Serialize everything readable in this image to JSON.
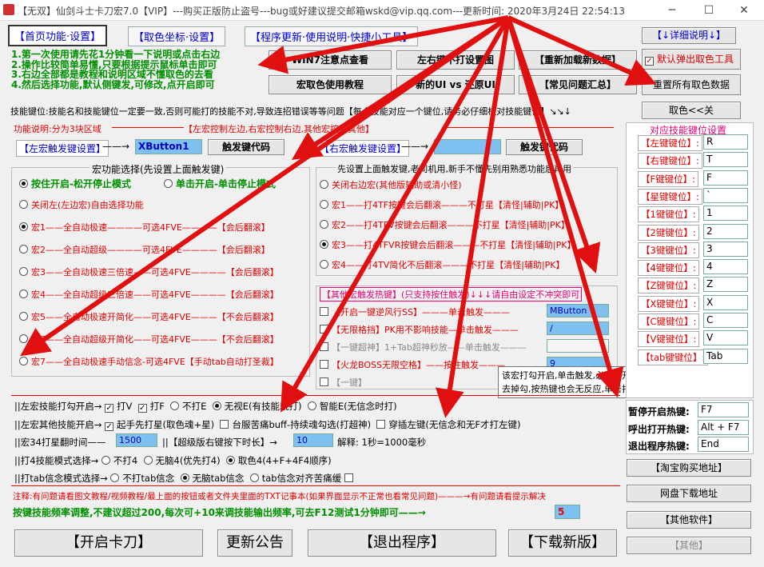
{
  "window": {
    "title": "【无双】仙剑斗士卡刀宏7.0【VIP】---购买正版防止盗号---bug或好建议提交邮箱wskd@vip.qq.com---更新时间: 2020年3月24日 22:54:13",
    "minimize": "─",
    "maximize": "☐",
    "close": "✕"
  },
  "tabs": [
    "【首页功能·设置】",
    "【取色坐标·设置】",
    "【程序更新·使用说明·快捷小工具】"
  ],
  "detail_btn": "【↓详细说明↓】",
  "intro": [
    "1.第一次使用请先花1分钟看一下说明或点击右边",
    "2.操作比较简单易懂,只要根据提示鼠标单击即可",
    "3.右边全部都是教程和说明区域不懂取色的去看",
    "4.然后选择功能,默认侧键发,可修改,点开启即可"
  ],
  "tut_buttons": [
    "WIN7注意点查看",
    "左右键不打设置图",
    "【重新加载新数据】",
    "宏取色使用教程",
    "新的UI vs 还原UI",
    "【常见问题汇总】"
  ],
  "popup_check": "默认弹出取色工具",
  "reset_btn": "重置所有取色数据",
  "skill_note": "技能键位:技能名和技能键位一定要一致,否则可能打的技能不对,导致连招错误等等问题【每个技能对应一个键位,请务必仔细核对技能键位】↘↘↓",
  "color_off": "取色<<关",
  "func_note": "功能说明:分为3块区域",
  "func_note2": "【左宏控制左边,右宏控制右边,其他宏控制其他】",
  "left_trigger": {
    "label": "【左宏触发键设置】",
    "value": "XButton1",
    "btn": "触发键代码"
  },
  "right_trigger": {
    "label": "【右宏触发键设置】",
    "value": "",
    "btn": "触发键代码"
  },
  "macro_title": "宏功能选择(先设置上面触发键)",
  "hold_mode": "按住开启-松开停止模式",
  "click_mode": "单击开启-单击停止模式",
  "left_macros": [
    "关闭左(左边宏)自由选择功能",
    "宏1——全自动极速————可选4FVE————【会后翻滚】",
    "宏2——全自动超级————可选4FVE————【会后翻滚】",
    "宏3——全自动极速三倍速——可选4FVE————【会后翻滚】",
    "宏4——全自动超级三倍速——可选4FVE————【会后翻滚】",
    "宏5——全自动极速开简化——可选4FVE———【不会后翻滚】",
    "宏6——全自动超级开简化——可选4FVE———【不会后翻滚】",
    "宏7——全自动极速手动信念-可选4FVE【手动tab自动打圣裁】"
  ],
  "right_title": "先设置上面触发键,老司机用,新手不懂先别用熟悉功能后再用",
  "right_macros": [
    "关闭右边宏(其他版辅助或清小怪)",
    "宏1——打4TF按键会后翻滚———不打星【清怪|辅助|PK】",
    "宏2——打4TFV按键会后翻滚———不打星【清怪|辅助|PK】",
    "宏3——打4TFVR按键会后翻滚———不打星【清怪|辅助|PK】",
    "宏4——打4TV简化不后翻滚———不打星【清怪|辅助|PK】"
  ],
  "other_title": "【其他宏触发热键】(只支持按住触发)↓↓↓请自由设定不冲突即可",
  "other_rows": [
    {
      "name": "【开启一键逆风行SS】",
      "mode": "———单击触发———",
      "value": "MButton"
    },
    {
      "name": "【无限格挡】PK用不影响技能",
      "mode": "—单击触发———",
      "value": "/"
    },
    {
      "name": "【一键超神】1+Tab超神秒放",
      "mode": "——单击触发———",
      "value": ""
    },
    {
      "name": "【火龙BOSS无限空格】",
      "mode": "——按住触发———",
      "value": "9"
    },
    {
      "name": "【一键】",
      "mode": "",
      "value": ""
    }
  ],
  "tooltip": [
    "该宏打勾开启,单击触发,必须松开其他卡刀宏热键",
    "去掉勾,按热键也会无反应,单击打勾开启!!!^_^"
  ],
  "opt1": {
    "label": "||左宏技能打勾开启→",
    "items": [
      "打V",
      "打F",
      "不打E",
      "无视E(有技能就打)",
      "智能E(无信念时打)"
    ]
  },
  "opt2": {
    "label": "||左宏其他技能开启→",
    "items": [
      "起手先打星(取色魂+星)",
      "台服苦痛buff-持续魂勾选(打超神)",
      "穿插左键(无信念和无F才打左键)"
    ]
  },
  "opt3": {
    "label": "||宏34打星翻时间——",
    "value1": "1500",
    "mid": "||【超级版右键按下时长】→",
    "value2": "10",
    "note": "解释: 1秒=1000毫秒"
  },
  "opt4": {
    "label": "||打4技能模式选择→",
    "items": [
      "不打4",
      "无脑4(优先打4)",
      "取色4(4+F+4F4顺序)"
    ]
  },
  "opt5": {
    "label": "||打tab信念模式选择→",
    "items": [
      "不打tab信念",
      "无脑tab信念",
      "tab信念对齐苦痛缓"
    ]
  },
  "note_bottom": "注释:有问题请看图文教程/视频教程/最上面的按钮或者文件夹里面的TXT记事本(如果界面显示不正常也看常见问题)———→有问题请看提示解决",
  "freq": {
    "text": "按键技能频率调整,不建议超过200,每次可+10来调技能输出频率,可去F12测试1分钟即可——→",
    "value": "5"
  },
  "bottom_buttons": [
    "【开启卡刀】",
    "更新公告",
    "【退出程序】",
    "【下载新版】"
  ],
  "right_panel": {
    "title": "对应技能键位设置",
    "keys": [
      {
        "label": "【左键键位】:",
        "value": "R"
      },
      {
        "label": "【右键键位】:",
        "value": "T"
      },
      {
        "label": "【F键键位】:",
        "value": "F"
      },
      {
        "label": "【星键键位】:",
        "value": "`"
      },
      {
        "label": "【1键键位】:",
        "value": "1"
      },
      {
        "label": "【2键键位】:",
        "value": "2"
      },
      {
        "label": "【3键键位】:",
        "value": "3"
      },
      {
        "label": "【4键键位】:",
        "value": "4"
      },
      {
        "label": "【Z键键位】:",
        "value": "Z"
      },
      {
        "label": "【X键键位】:",
        "value": "X"
      },
      {
        "label": "【C键键位】:",
        "value": "C"
      },
      {
        "label": "【V键键位】:",
        "value": "V"
      },
      {
        "label": "【tab键键位】:",
        "value": "Tab"
      }
    ],
    "hotkeys": [
      {
        "label": "暂停开启热键:",
        "value": "F7"
      },
      {
        "label": "呼出打开热键:",
        "value": "Alt + F7"
      },
      {
        "label": "退出程序热键:",
        "value": "End"
      }
    ],
    "links": [
      "【淘宝购买地址】",
      "网盘下载地址",
      "【其他软件】",
      "【其他】"
    ]
  }
}
